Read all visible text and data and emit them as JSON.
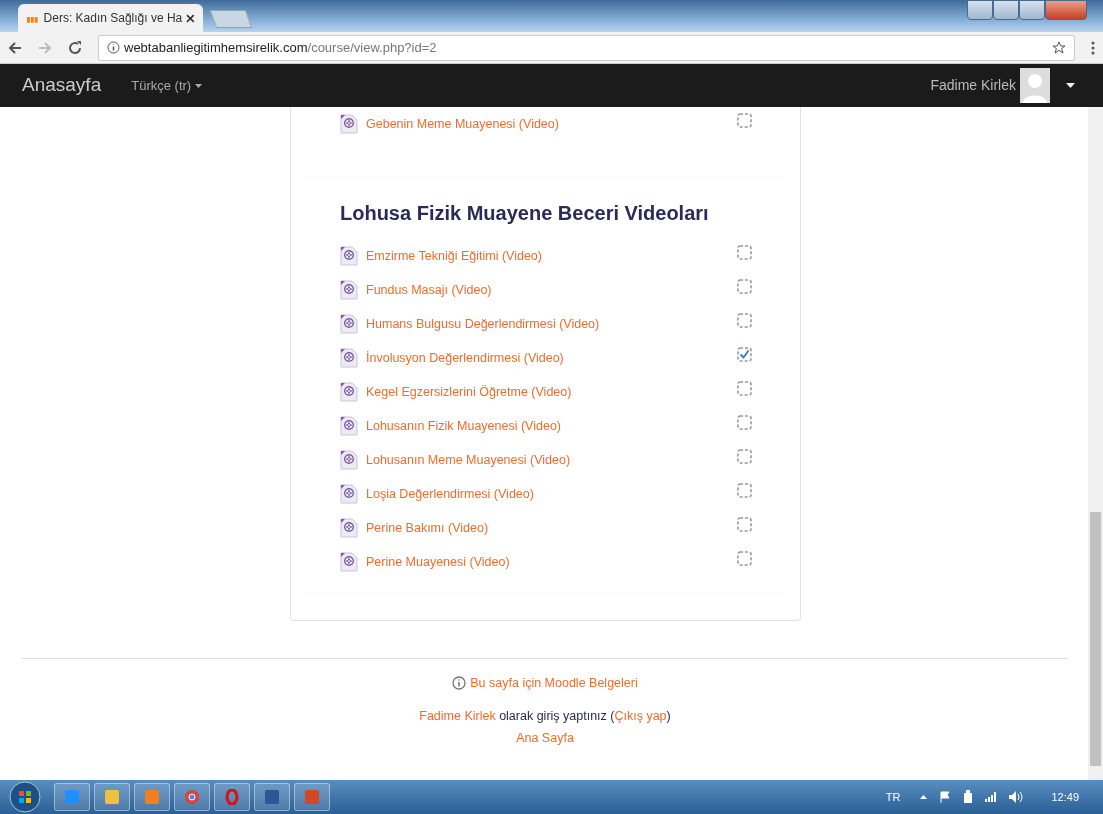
{
  "browser": {
    "tab_title": "Ders: Kadın Sağlığı ve Ha",
    "url_host": "webtabanliegitimhemsirelik.com",
    "url_path": "/course/view.php?id=2"
  },
  "navbar": {
    "brand": "Anasayfa",
    "language": "Türkçe (tr)",
    "user": "Fadime Kirlek"
  },
  "sections": [
    {
      "items": [
        {
          "label": "Gebenin Meme Muayenesi (Video)",
          "checked": false
        }
      ]
    },
    {
      "title": "Lohusa Fizik Muayene Beceri Videoları",
      "items": [
        {
          "label": "Emzirme Tekniği Eğitimi (Video)",
          "checked": false
        },
        {
          "label": "Fundus Masajı (Video)",
          "checked": false
        },
        {
          "label": "Humans Bulgusu Değerlendirmesi (Video)",
          "checked": false
        },
        {
          "label": "İnvolusyon Değerlendirmesi (Video)",
          "checked": true
        },
        {
          "label": "Kegel Egzersizlerini Öğretme (Video)",
          "checked": false
        },
        {
          "label": "Lohusanın Fizik Muayenesi (Video)",
          "checked": false
        },
        {
          "label": "Lohusanın Meme Muayenesi (Video)",
          "checked": false
        },
        {
          "label": "Loşia Değerlendirmesi (Video)",
          "checked": false
        },
        {
          "label": "Perine Bakımı (Video)",
          "checked": false
        },
        {
          "label": "Perine Muayenesi (Video)",
          "checked": false
        }
      ]
    }
  ],
  "footer": {
    "docs_link": "Bu sayfa için Moodle Belgeleri",
    "login_user": "Fadime Kirlek",
    "login_text": "olarak giriş yaptınız (",
    "logout": "Çıkış yap",
    "login_end": ")",
    "home": "Ana Sayfa"
  },
  "taskbar": {
    "language": "TR",
    "time": "12:49"
  }
}
